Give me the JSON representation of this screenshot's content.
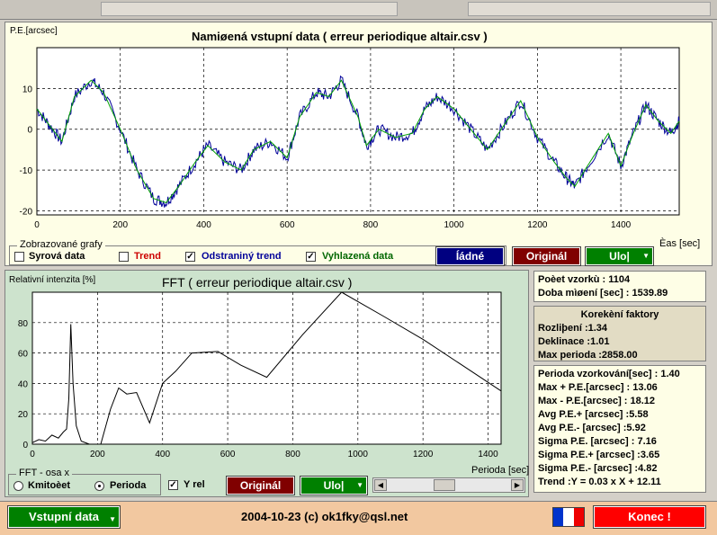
{
  "top": {
    "ylabel": "P.E.[arcsec]",
    "title": "Namiøená vstupní data ( erreur periodique altair.csv )",
    "xlabel": "Èas [sec]",
    "display_legend": "Zobrazované grafy",
    "checks": [
      {
        "label": "Syrová data",
        "checked": false,
        "color": "#000000"
      },
      {
        "label": "Trend",
        "checked": false,
        "color": "#cc0000"
      },
      {
        "label": "Odstraniný trend",
        "checked": true,
        "color": "#000099"
      },
      {
        "label": "Vyhlazená data",
        "checked": true,
        "color": "#006600"
      }
    ],
    "buttons": {
      "none": "Íádné",
      "original": "Originál",
      "save": "Ulo|"
    }
  },
  "fft": {
    "ylabel": "Relativní intenzita [%]",
    "title": "FFT ( erreur periodique altair.csv )",
    "xlabel": "Perioda [sec]",
    "axis_legend": "FFT - osa x",
    "radio_freq": "Kmitoèet",
    "radio_period": "Perioda",
    "yrel": "Y rel",
    "btn_original": "Originál",
    "btn_save": "Ulo|"
  },
  "info1": {
    "samples": "Poèet vzorkù : 1104",
    "duration": "Doba mìøení [sec] : 1539.89"
  },
  "info2": {
    "title": "Korekèní faktory",
    "resolution": "Rozliþení :1.34",
    "declination": "Deklinace :1.01",
    "max_period": "Max perioda :2858.00"
  },
  "info3": {
    "lines": [
      "Perioda vzorkování[sec] : 1.40",
      "Max + P.E.[arcsec] : 13.06",
      "Max - P.E.[arcsec] : 18.12",
      "Avg P.E.+ [arcsec] :5.58",
      "Avg P.E.- [arcsec] :5.92",
      "Sigma P.E. [arcsec] : 7.16",
      "Sigma P.E.+ [arcsec] :3.65",
      "Sigma P.E.- [arcsec] :4.82",
      "Trend :Y = 0.03 x X + 12.11"
    ]
  },
  "status": {
    "input_btn": "Vstupní data",
    "copyright": "2004-10-23 (c) ok1fky@qsl.net",
    "end_btn": "Konec !"
  },
  "chart_data": [
    {
      "type": "line",
      "title": "Namiøená vstupní data ( erreur periodique altair.csv )",
      "xlabel": "Èas [sec]",
      "ylabel": "P.E.[arcsec]",
      "xlim": [
        0,
        1540
      ],
      "ylim": [
        -21,
        20
      ],
      "xticks": [
        0,
        200,
        400,
        600,
        800,
        1000,
        1200,
        1400
      ],
      "yticks": [
        -20,
        -10,
        0,
        10
      ],
      "grid": true,
      "series": [
        {
          "color": "#000099",
          "x": [
            0,
            30,
            60,
            90,
            130,
            160,
            200,
            240,
            280,
            310,
            340,
            380,
            410,
            450,
            490,
            520,
            560,
            600,
            630,
            670,
            700,
            730,
            770,
            790,
            820,
            860,
            900,
            930,
            960,
            1000,
            1040,
            1080,
            1120,
            1160,
            1200,
            1240,
            1270,
            1290,
            1320,
            1370,
            1400,
            1430,
            1460,
            1490,
            1520,
            1540
          ],
          "y": [
            5,
            1,
            -3,
            8,
            12,
            9,
            0,
            -10,
            -17,
            -18,
            -14,
            -8,
            -4,
            -8,
            -10,
            -5,
            -3,
            -7,
            3,
            9,
            8,
            12,
            3,
            -4,
            0,
            -2,
            -1,
            5,
            8,
            5,
            0,
            -5,
            1,
            7,
            -2,
            -8,
            -12,
            -14,
            -9,
            -1,
            -9,
            -1,
            6,
            2,
            -1,
            2
          ]
        }
      ]
    },
    {
      "type": "line",
      "title": "FFT ( erreur periodique altair.csv )",
      "xlabel": "Perioda [sec]",
      "ylabel": "Relativní intenzita [%]",
      "xlim": [
        0,
        1440
      ],
      "ylim": [
        0,
        100
      ],
      "xticks": [
        0,
        200,
        400,
        600,
        800,
        1000,
        1200,
        1400
      ],
      "yticks": [
        0,
        20,
        40,
        60,
        80
      ],
      "grid": true,
      "series": [
        {
          "color": "#000000",
          "x": [
            0,
            20,
            40,
            60,
            80,
            95,
            105,
            112,
            118,
            125,
            135,
            150,
            175,
            210,
            240,
            265,
            290,
            320,
            360,
            400,
            440,
            490,
            570,
            640,
            720,
            830,
            950,
            1080,
            1200,
            1320,
            1440
          ],
          "y": [
            1,
            3,
            2,
            6,
            4,
            8,
            10,
            30,
            79,
            40,
            12,
            2,
            0,
            0,
            23,
            37,
            33,
            34,
            14,
            40,
            48,
            60,
            61,
            52,
            44,
            72,
            100,
            84,
            69,
            52,
            35
          ]
        }
      ]
    }
  ]
}
